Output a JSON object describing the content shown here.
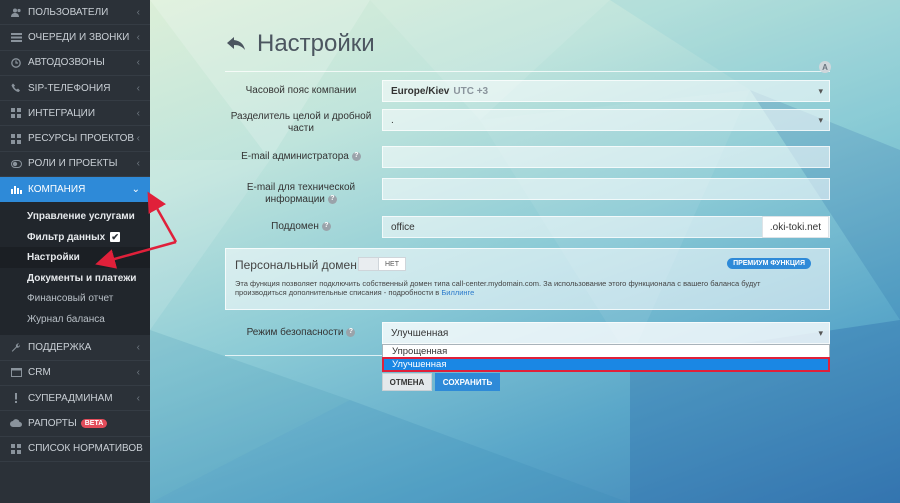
{
  "sidebar": {
    "items": [
      {
        "label": "Пользователи",
        "icon": "users-icon"
      },
      {
        "label": "Очереди и звонки",
        "icon": "list-icon"
      },
      {
        "label": "Автодозвоны",
        "icon": "clock-icon"
      },
      {
        "label": "SIP-телефония",
        "icon": "phone-icon"
      },
      {
        "label": "Интеграции",
        "icon": "grid-icon"
      },
      {
        "label": "Ресурсы проектов",
        "icon": "grid-icon"
      },
      {
        "label": "Роли и проекты",
        "icon": "toggle-icon"
      },
      {
        "label": "Компания",
        "icon": "bar-chart-icon"
      }
    ],
    "submenu": [
      {
        "label": "Управление услугами"
      },
      {
        "label": "Фильтр данных"
      },
      {
        "label": "Настройки"
      },
      {
        "label": "Документы и платежи"
      },
      {
        "label": "Финансовый отчет"
      },
      {
        "label": "Журнал баланса"
      }
    ],
    "items_after": [
      {
        "label": "Поддержка",
        "icon": "wrench-icon"
      },
      {
        "label": "CRM",
        "icon": "crm-icon"
      },
      {
        "label": "Суперадминам",
        "icon": "alert-icon"
      },
      {
        "label": "Рапорты",
        "icon": "cloud-icon",
        "badge": "beta"
      },
      {
        "label": "Список нормативов",
        "icon": "grid-icon"
      }
    ]
  },
  "page": {
    "title": "Настройки",
    "a_badge": "A"
  },
  "form": {
    "timezone": {
      "label": "Часовой пояс компании",
      "value": "Europe/Kiev",
      "utc": "UTC +3"
    },
    "separator": {
      "label": "Разделитель целой и дробной части",
      "value": "."
    },
    "admin_email": {
      "label": "E-mail администратора",
      "value": ""
    },
    "tech_email": {
      "label": "E-mail для технической информации",
      "value": ""
    },
    "subdomain": {
      "label": "Поддомен",
      "value": "office",
      "suffix": ".oki-toki.net"
    },
    "domain": {
      "title": "Персональный домен",
      "toggle": "НЕТ",
      "premium": "Премиум функция",
      "desc": "Эта функция позволяет подключить собственный домен типа call-center.mydomain.com. За использование этого функционала с вашего баланса будут производиться дополнительные списания - подробности в",
      "link": "Биллинге"
    },
    "security": {
      "label": "Режим безопасности",
      "value": "Улучшенная",
      "options": [
        "Упрощенная",
        "Улучшенная"
      ]
    },
    "cancel": "Отмена",
    "save": "Сохранить"
  },
  "colors": {
    "sidebar_bg": "#2b3138",
    "active": "#2e8ad8",
    "annotation": "#e0203a"
  }
}
